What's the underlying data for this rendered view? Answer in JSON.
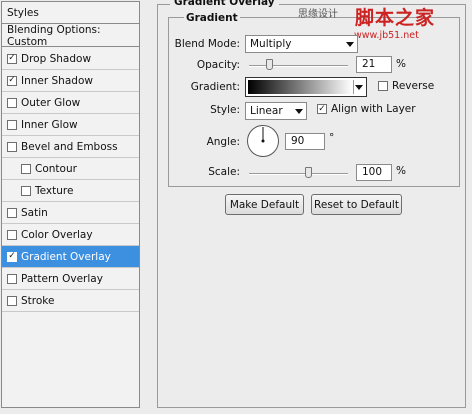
{
  "styles_panel": {
    "header": "Styles",
    "blending_options": "Blending Options: Custom",
    "items": [
      {
        "label": "Drop Shadow",
        "checked": true,
        "selected": false,
        "indent": false
      },
      {
        "label": "Inner Shadow",
        "checked": true,
        "selected": false,
        "indent": false
      },
      {
        "label": "Outer Glow",
        "checked": false,
        "selected": false,
        "indent": false
      },
      {
        "label": "Inner Glow",
        "checked": false,
        "selected": false,
        "indent": false
      },
      {
        "label": "Bevel and Emboss",
        "checked": false,
        "selected": false,
        "indent": false
      },
      {
        "label": "Contour",
        "checked": false,
        "selected": false,
        "indent": true
      },
      {
        "label": "Texture",
        "checked": false,
        "selected": false,
        "indent": true
      },
      {
        "label": "Satin",
        "checked": false,
        "selected": false,
        "indent": false
      },
      {
        "label": "Color Overlay",
        "checked": false,
        "selected": false,
        "indent": false
      },
      {
        "label": "Gradient Overlay",
        "checked": true,
        "selected": true,
        "indent": false
      },
      {
        "label": "Pattern Overlay",
        "checked": false,
        "selected": false,
        "indent": false
      },
      {
        "label": "Stroke",
        "checked": false,
        "selected": false,
        "indent": false
      }
    ],
    "selected_color": "#3d8fdf"
  },
  "watermark": {
    "cn_text": "思缘设计",
    "big_text": "脚本之家",
    "url": "www.jb51.net"
  },
  "gradient_overlay": {
    "section_title": "Gradient Overlay",
    "group_title": "Gradient",
    "blend_mode_label": "Blend Mode:",
    "blend_mode_value": "Multiply",
    "opacity_label": "Opacity:",
    "opacity_value": "21",
    "opacity_unit": "%",
    "opacity_slider_level": 0.21,
    "gradient_label": "Gradient:",
    "reverse_label": "Reverse",
    "reverse_checked": false,
    "style_label": "Style:",
    "style_value": "Linear",
    "align_with_layer_label": "Align with Layer",
    "align_with_layer_checked": true,
    "angle_label": "Angle:",
    "angle_value": "90",
    "angle_unit": "°",
    "scale_label": "Scale:",
    "scale_value": "100",
    "scale_unit": "%",
    "scale_slider_level": 0.6
  },
  "buttons": {
    "make_default": "Make Default",
    "reset_to_default": "Reset to Default"
  }
}
